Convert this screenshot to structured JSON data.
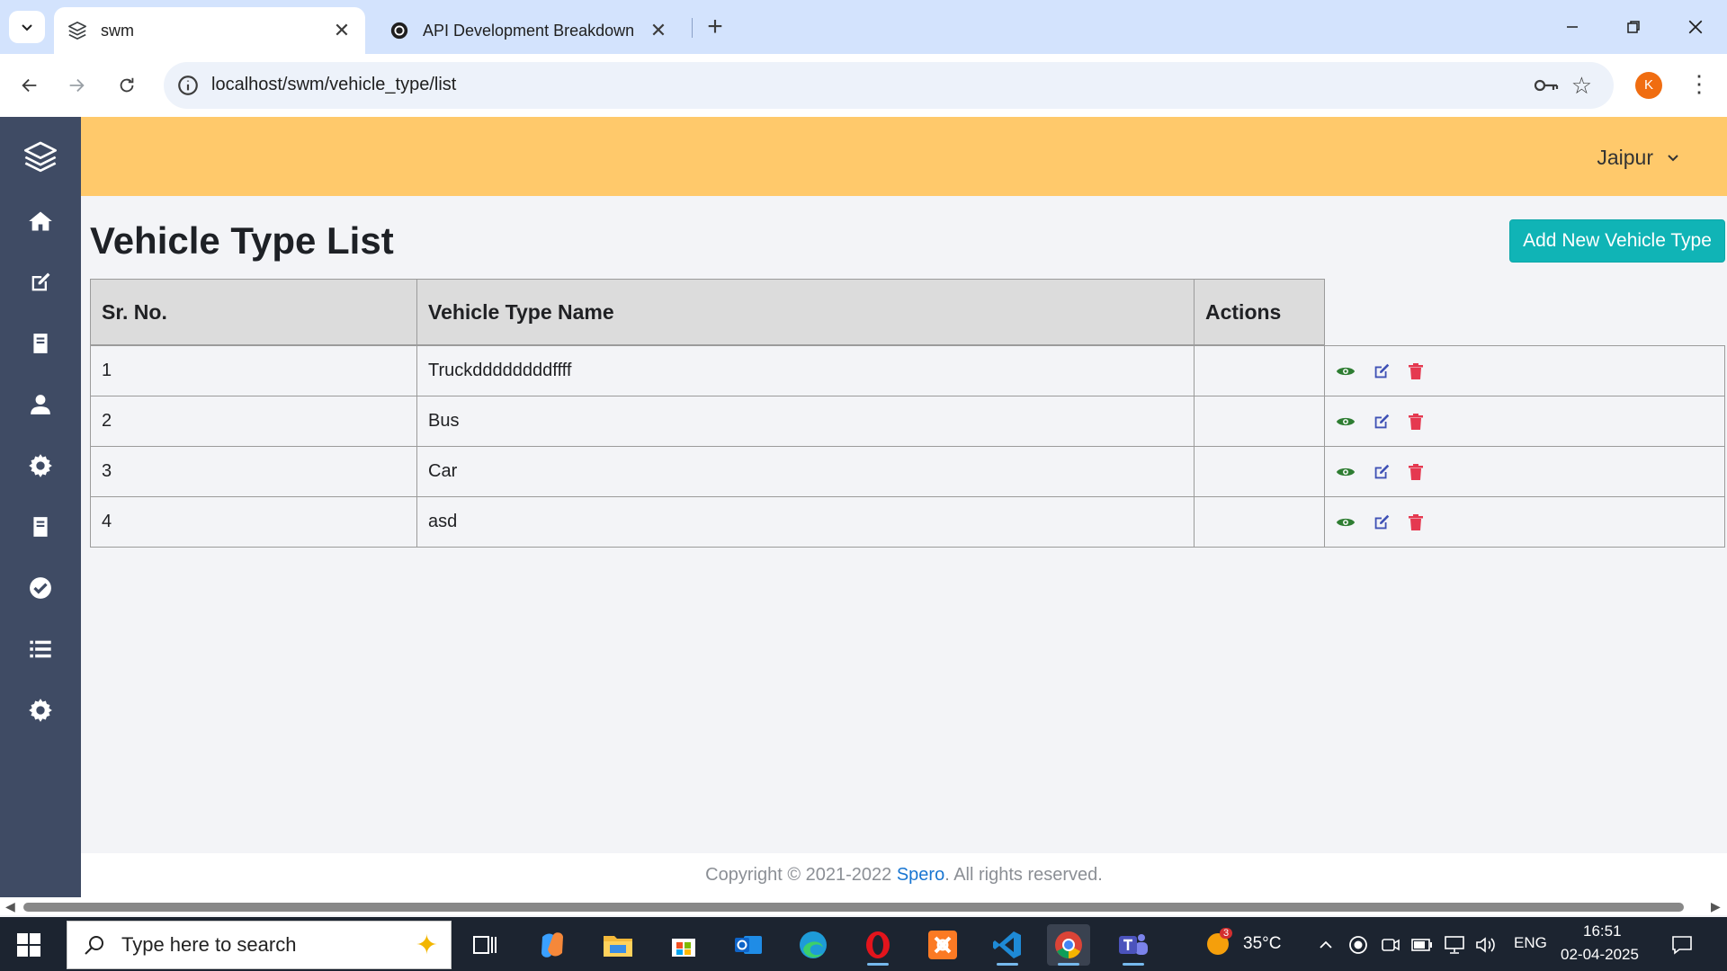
{
  "browser": {
    "tabs": [
      {
        "title": "swm",
        "active": true
      },
      {
        "title": "API Development Breakdown",
        "active": false
      }
    ],
    "url": "localhost/swm/vehicle_type/list",
    "profile_initial": "K"
  },
  "header": {
    "city": "Jaipur"
  },
  "page": {
    "title": "Vehicle Type List",
    "add_button_label": "Add New Vehicle Type"
  },
  "table": {
    "columns": [
      "Sr. No.",
      "Vehicle Type Name",
      "Actions"
    ],
    "rows": [
      {
        "sr": "1",
        "name": "Truckddddddddffff"
      },
      {
        "sr": "2",
        "name": "Bus"
      },
      {
        "sr": "3",
        "name": "Car"
      },
      {
        "sr": "4",
        "name": "asd"
      }
    ]
  },
  "footer": {
    "prefix": "Copyright © 2021-2022 ",
    "brand": "Spero",
    "suffix": ". All rights reserved."
  },
  "taskbar": {
    "search_placeholder": "Type here to search",
    "weather_temp": "35°C",
    "weather_badge": "3",
    "language": "ENG",
    "time": "16:51",
    "date": "02-04-2025"
  },
  "colors": {
    "sidebar": "#3f4b64",
    "header": "#ffc96b",
    "accent": "#10b4b6",
    "view_icon": "#2e7d32",
    "edit_icon": "#3f51b5",
    "delete_icon": "#e53950"
  }
}
